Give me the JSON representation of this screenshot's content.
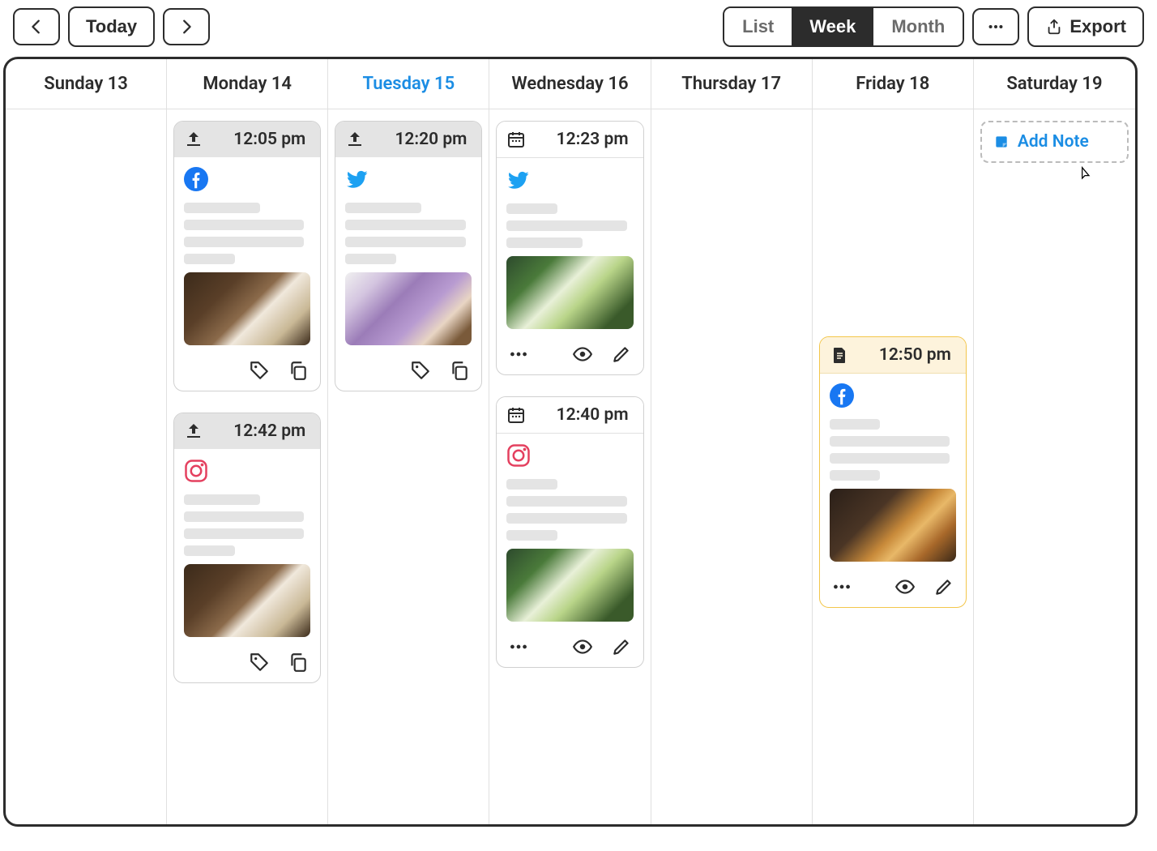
{
  "toolbar": {
    "today_label": "Today",
    "views": {
      "list": "List",
      "week": "Week",
      "month": "Month",
      "active": "week"
    },
    "export_label": "Export"
  },
  "days": [
    {
      "label": "Sunday 13",
      "today": false
    },
    {
      "label": "Monday 14",
      "today": false
    },
    {
      "label": "Tuesday 15",
      "today": true
    },
    {
      "label": "Wednesday 16",
      "today": false
    },
    {
      "label": "Thursday 17",
      "today": false
    },
    {
      "label": "Friday 18",
      "today": false
    },
    {
      "label": "Saturday 19",
      "today": false
    }
  ],
  "cards": {
    "mon1": {
      "time": "12:05 pm",
      "status": "scheduled",
      "platform": "facebook",
      "thumb": "coffee",
      "actions": [
        "tag",
        "copy"
      ]
    },
    "mon2": {
      "time": "12:42 pm",
      "status": "scheduled",
      "platform": "instagram",
      "thumb": "coffee",
      "actions": [
        "tag",
        "copy"
      ]
    },
    "tue1": {
      "time": "12:20 pm",
      "status": "scheduled",
      "platform": "twitter",
      "thumb": "lilac",
      "actions": [
        "tag",
        "copy"
      ]
    },
    "wed1": {
      "time": "12:23 pm",
      "status": "calendar",
      "platform": "twitter",
      "thumb": "matcha",
      "actions": [
        "more",
        "eye",
        "edit"
      ]
    },
    "wed2": {
      "time": "12:40 pm",
      "status": "calendar",
      "platform": "instagram",
      "thumb": "matcha",
      "actions": [
        "more",
        "eye",
        "edit"
      ]
    },
    "fri1": {
      "time": "12:50 pm",
      "status": "draft",
      "platform": "facebook",
      "thumb": "whiskey",
      "actions": [
        "more",
        "eye",
        "edit"
      ]
    }
  },
  "add_note_label": "Add Note"
}
